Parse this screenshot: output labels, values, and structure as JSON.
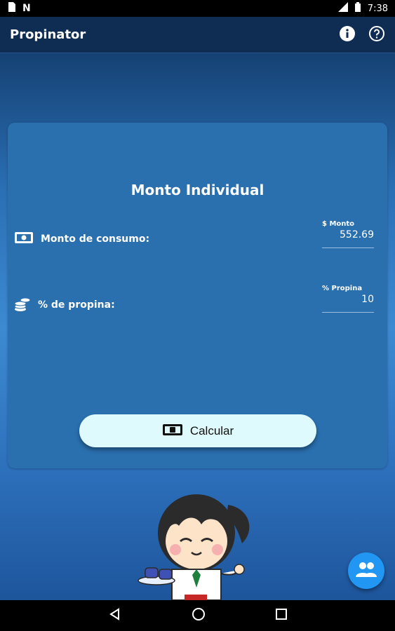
{
  "status_bar": {
    "time": "7:38"
  },
  "app_bar": {
    "title": "Propinator",
    "info_icon": "info-icon",
    "help_icon": "help-icon"
  },
  "card": {
    "title": "Monto Individual",
    "rows": [
      {
        "label": "Monto de consumo:",
        "field_label": "$ Monto",
        "value": "552.69",
        "icon": "cash-icon"
      },
      {
        "label": "% de propina:",
        "field_label": "% Propina",
        "value": "10",
        "icon": "coins-icon"
      }
    ],
    "button": {
      "label": "Calcular",
      "icon": "cash-icon"
    }
  },
  "fab": {
    "icon": "people-icon"
  },
  "colors": {
    "accent": "#2196f3",
    "button_bg": "#dffafc",
    "card_bg": "#2a6fae",
    "appbar_bg": "#0f2d52"
  }
}
